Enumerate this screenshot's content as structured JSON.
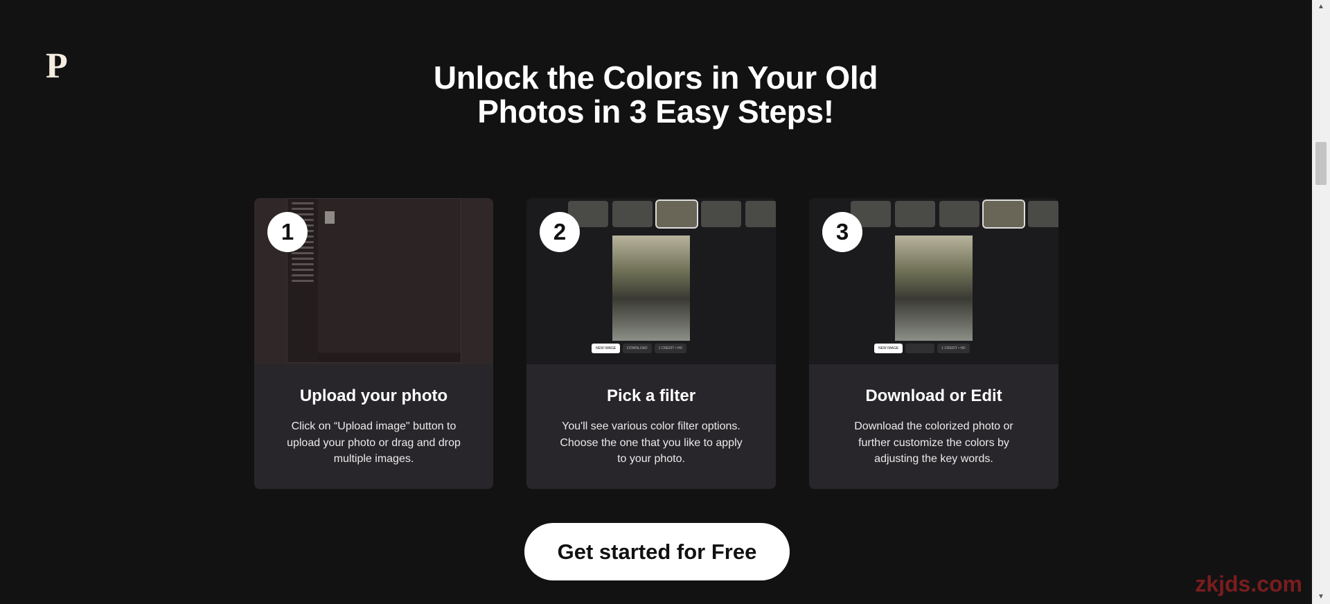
{
  "logo": "P",
  "headline": [
    "Unlock the Colors in Your Old",
    "Photos in 3 Easy Steps!"
  ],
  "steps": [
    {
      "number": "1",
      "title": "Upload your photo",
      "desc": "Click on “Upload image\" button to upload your photo or drag and drop multiple images."
    },
    {
      "number": "2",
      "title": "Pick a filter",
      "desc": "You'll see various color filter options. Choose the one that you like to apply to your photo."
    },
    {
      "number": "3",
      "title": "Download or Edit",
      "desc": "Download the colorized photo or further customize the colors by adjusting the key words."
    }
  ],
  "mock": {
    "new_image": "NEW IMAGE",
    "download": "DOWNLOAD",
    "credit": "1 CREDIT • HD"
  },
  "cta": "Get started for Free",
  "watermark": "zkjds.com"
}
